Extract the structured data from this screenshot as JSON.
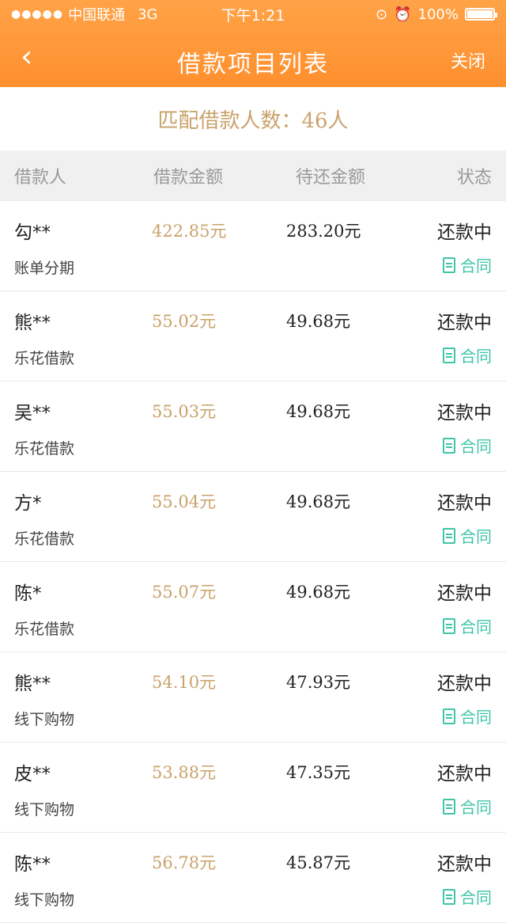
{
  "status_bar": {
    "carrier": "中国联通",
    "network": "3G",
    "time": "下午1:21",
    "battery": "100%"
  },
  "nav": {
    "back_icon": "chevron-left-icon",
    "title": "借款项目列表",
    "close_label": "关闭"
  },
  "summary": {
    "text": "匹配借款人数：46人"
  },
  "table": {
    "headers": [
      "借款人",
      "借款金额",
      "待还金额",
      "状态"
    ],
    "rows": [
      {
        "name": "勾**",
        "type": "账单分期",
        "amount": "422.85元",
        "due": "283.20元",
        "status": "还款中",
        "contract": "合同"
      },
      {
        "name": "熊**",
        "type": "乐花借款",
        "amount": "55.02元",
        "due": "49.68元",
        "status": "还款中",
        "contract": "合同"
      },
      {
        "name": "吴**",
        "type": "乐花借款",
        "amount": "55.03元",
        "due": "49.68元",
        "status": "还款中",
        "contract": "合同"
      },
      {
        "name": "方*",
        "type": "乐花借款",
        "amount": "55.04元",
        "due": "49.68元",
        "status": "还款中",
        "contract": "合同"
      },
      {
        "name": "陈*",
        "type": "乐花借款",
        "amount": "55.07元",
        "due": "49.68元",
        "status": "还款中",
        "contract": "合同"
      },
      {
        "name": "熊**",
        "type": "线下购物",
        "amount": "54.10元",
        "due": "47.93元",
        "status": "还款中",
        "contract": "合同"
      },
      {
        "name": "皮**",
        "type": "线下购物",
        "amount": "53.88元",
        "due": "47.35元",
        "status": "还款中",
        "contract": "合同"
      },
      {
        "name": "陈**",
        "type": "线下购物",
        "amount": "56.78元",
        "due": "45.87元",
        "status": "还款中",
        "contract": "合同"
      }
    ]
  },
  "colors": {
    "header": "#ff9a3c",
    "gold": "#c9a26a",
    "teal": "#3fc4a8"
  }
}
